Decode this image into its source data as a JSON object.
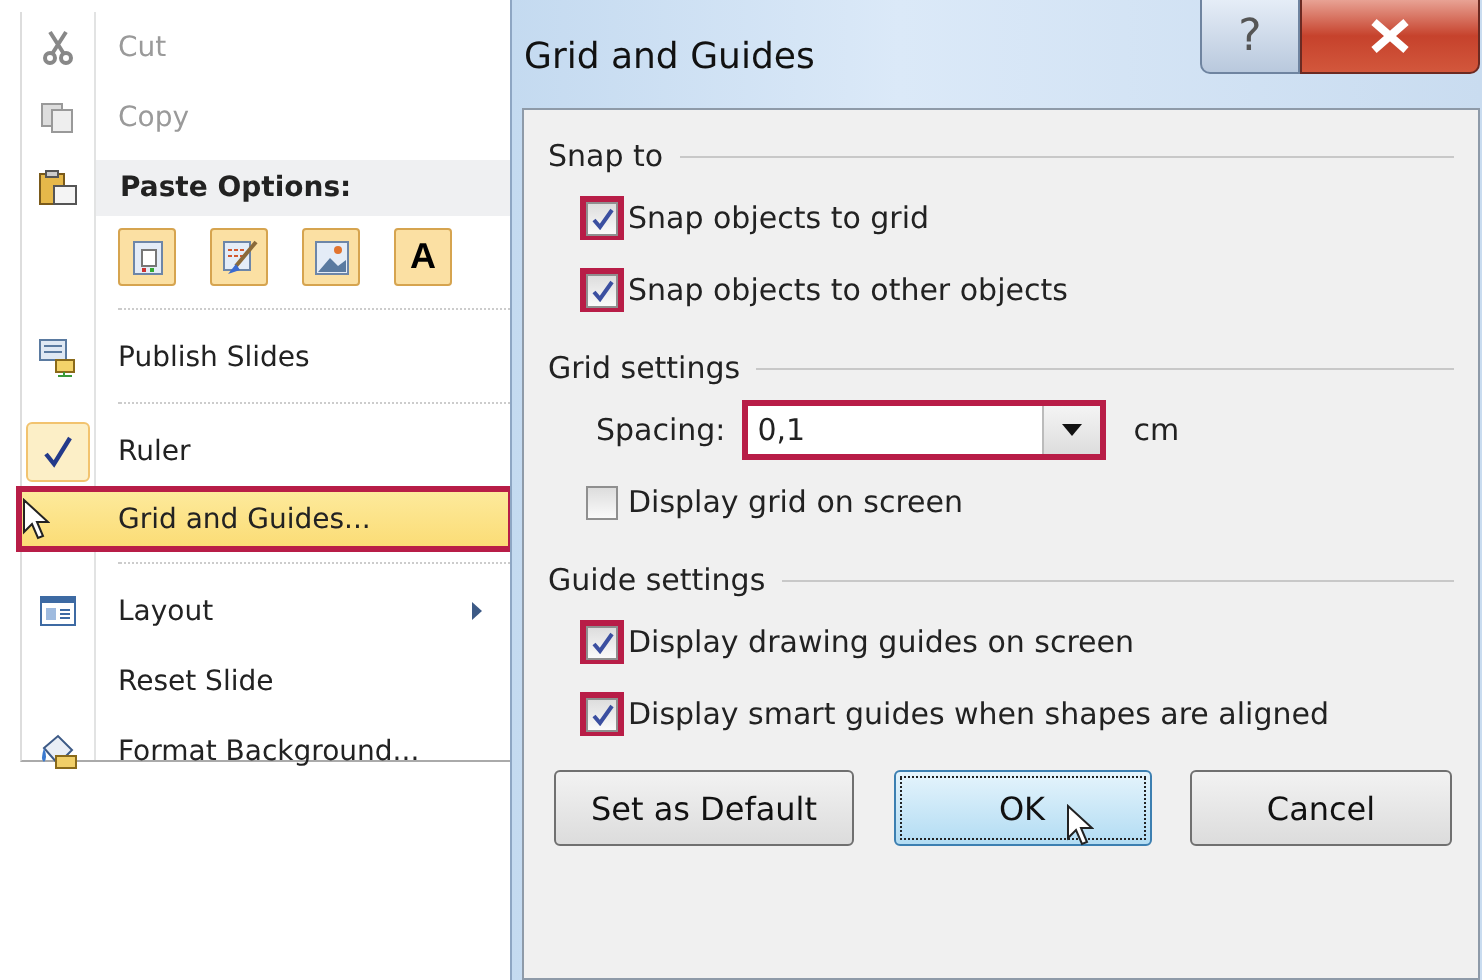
{
  "context_menu": {
    "items": [
      {
        "kind": "item",
        "label": "Cut",
        "disabled": true,
        "checked": false,
        "highlighted": false,
        "submenu": false
      },
      {
        "kind": "item",
        "label": "Copy",
        "disabled": true,
        "checked": false,
        "highlighted": false,
        "submenu": false
      },
      {
        "kind": "header",
        "label": "Paste Options:"
      },
      {
        "kind": "paste_options",
        "options": [
          {
            "kind": "keep"
          },
          {
            "kind": "brush"
          },
          {
            "kind": "picture"
          },
          {
            "kind": "text",
            "label": "A"
          }
        ]
      },
      {
        "kind": "separator"
      },
      {
        "kind": "item",
        "label": "Publish Slides",
        "disabled": false,
        "checked": false,
        "highlighted": false,
        "submenu": false
      },
      {
        "kind": "separator"
      },
      {
        "kind": "item",
        "label": "Ruler",
        "disabled": false,
        "checked": true,
        "highlighted": false,
        "submenu": false
      },
      {
        "kind": "item",
        "label": "Grid and Guides...",
        "disabled": false,
        "checked": false,
        "highlighted": true,
        "submenu": false
      },
      {
        "kind": "separator"
      },
      {
        "kind": "item",
        "label": "Layout",
        "disabled": false,
        "checked": false,
        "highlighted": false,
        "submenu": true
      },
      {
        "kind": "item",
        "label": "Reset Slide",
        "disabled": false,
        "checked": false,
        "highlighted": false,
        "submenu": false
      },
      {
        "kind": "item",
        "label": "Format Background...",
        "disabled": false,
        "checked": false,
        "highlighted": false,
        "submenu": false
      }
    ]
  },
  "dialog": {
    "title": "Grid and Guides",
    "help_glyph": "?",
    "sections": [
      {
        "heading": "Snap to",
        "rows": [
          {
            "kind": "checkbox",
            "label": "Snap objects to grid",
            "checked": true,
            "highlighted": true
          },
          {
            "kind": "checkbox",
            "label": "Snap objects to other objects",
            "checked": true,
            "highlighted": true
          }
        ]
      },
      {
        "heading": "Grid settings",
        "rows": [
          {
            "kind": "combo",
            "label": "Spacing:",
            "value": "0,1",
            "unit": "cm",
            "highlighted": true
          },
          {
            "kind": "checkbox",
            "label": "Display grid on screen",
            "checked": false,
            "highlighted": false
          }
        ]
      },
      {
        "heading": "Guide settings",
        "rows": [
          {
            "kind": "checkbox",
            "label": "Display drawing guides on screen",
            "checked": true,
            "highlighted": true
          },
          {
            "kind": "checkbox",
            "label": "Display smart guides when shapes are aligned",
            "checked": true,
            "highlighted": true
          }
        ]
      }
    ],
    "buttons": [
      {
        "label": "Set as Default",
        "selected": false
      },
      {
        "label": "OK",
        "selected": true
      },
      {
        "label": "Cancel",
        "selected": false
      }
    ]
  }
}
